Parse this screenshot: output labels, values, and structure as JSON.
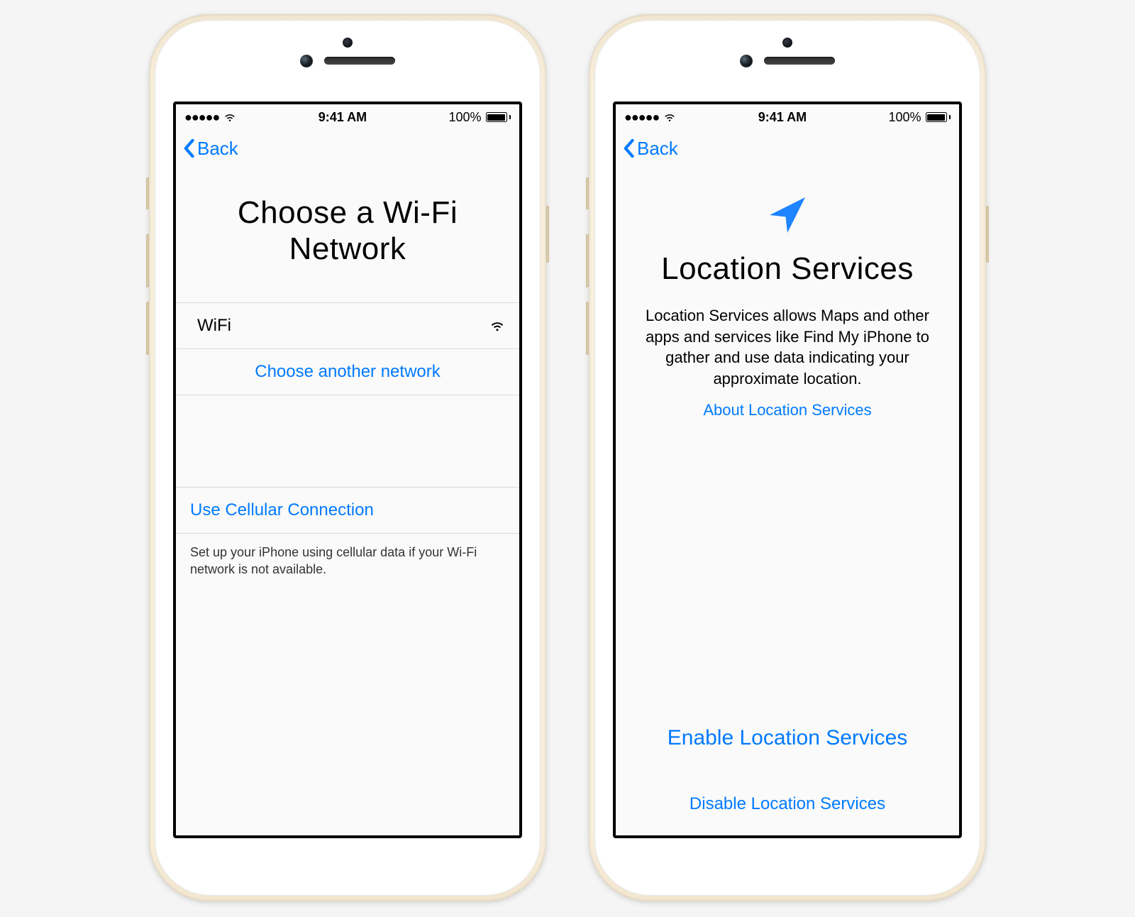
{
  "status": {
    "time": "9:41 AM",
    "battery_pct": "100%"
  },
  "nav": {
    "back": "Back"
  },
  "wifi_screen": {
    "title": "Choose a Wi-Fi\nNetwork",
    "network_name": "WiFi",
    "choose_another": "Choose another network",
    "use_cellular": "Use Cellular Connection",
    "cellular_help": "Set up your iPhone using cellular data if your Wi-Fi network is not available."
  },
  "location_screen": {
    "title": "Location Services",
    "description": "Location Services allows Maps and other apps and services like Find My iPhone to gather and use data indicating your approximate location.",
    "about_link": "About Location Services",
    "enable": "Enable Location Services",
    "disable": "Disable Location Services"
  },
  "colors": {
    "link": "#007aff"
  }
}
